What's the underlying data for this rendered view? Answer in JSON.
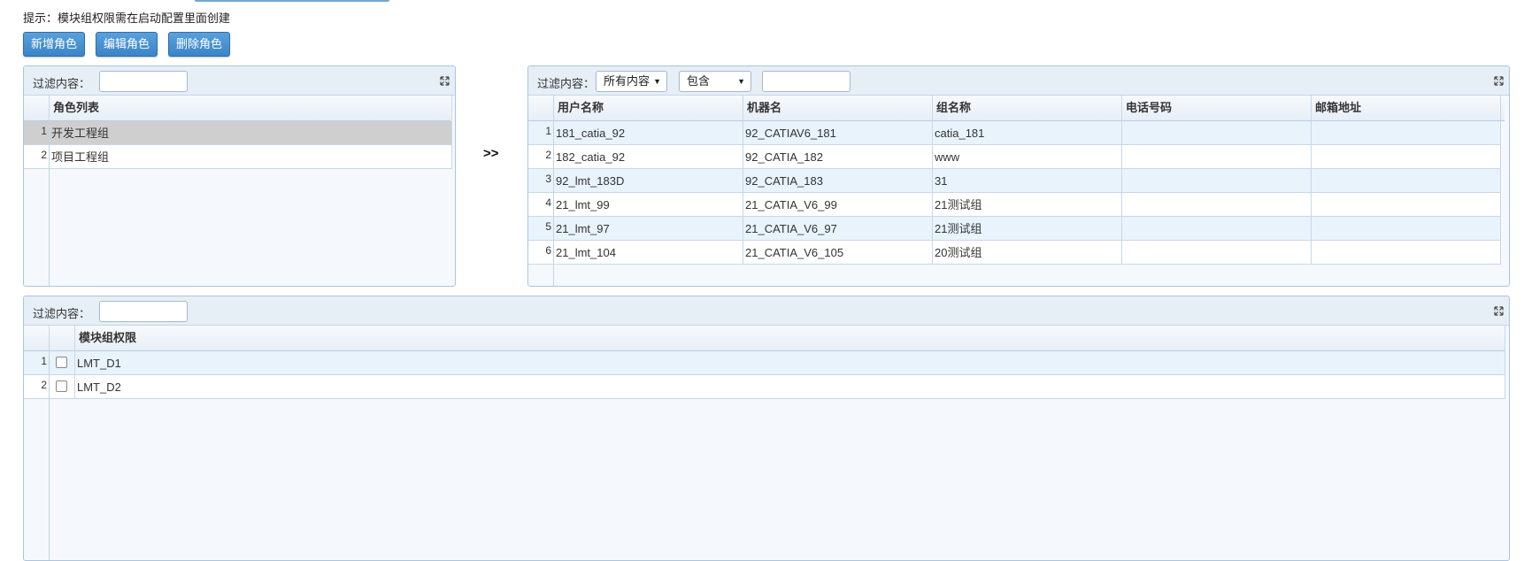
{
  "hint": "提示：模块组权限需在启动配置里面创建",
  "toolbar": {
    "add_label": "新增角色",
    "edit_label": "编辑角色",
    "delete_label": "删除角色"
  },
  "role_panel": {
    "filter_label": "过滤内容：",
    "filter_value": "",
    "column_header": "角色列表",
    "rows": [
      {
        "num": "1",
        "name": "开发工程组"
      },
      {
        "num": "2",
        "name": "项目工程组"
      }
    ]
  },
  "transfer_arrow": ">>",
  "user_panel": {
    "filter_label": "过滤内容：",
    "field_select": "所有内容",
    "op_select": "包含",
    "filter_value": "",
    "headers": [
      "用户名称",
      "机器名",
      "组名称",
      "电话号码",
      "邮箱地址"
    ],
    "rows": [
      {
        "num": "1",
        "user": "181_catia_92",
        "machine": "92_CATIAV6_181",
        "group": "catia_181",
        "phone": "",
        "email": ""
      },
      {
        "num": "2",
        "user": "182_catia_92",
        "machine": "92_CATIA_182",
        "group": "www",
        "phone": "",
        "email": ""
      },
      {
        "num": "3",
        "user": "92_lmt_183D",
        "machine": "92_CATIA_183",
        "group": "31",
        "phone": "",
        "email": ""
      },
      {
        "num": "4",
        "user": "21_lmt_99",
        "machine": "21_CATIA_V6_99",
        "group": "21测试组",
        "phone": "",
        "email": ""
      },
      {
        "num": "5",
        "user": "21_lmt_97",
        "machine": "21_CATIA_V6_97",
        "group": "21测试组",
        "phone": "",
        "email": ""
      },
      {
        "num": "6",
        "user": "21_lmt_104",
        "machine": "21_CATIA_V6_105",
        "group": "20测试组",
        "phone": "",
        "email": ""
      }
    ]
  },
  "module_panel": {
    "filter_label": "过滤内容：",
    "filter_value": "",
    "column_header": "模块组权限",
    "rows": [
      {
        "num": "1",
        "name": "LMT_D1",
        "checked": false
      },
      {
        "num": "2",
        "name": "LMT_D2",
        "checked": false
      }
    ]
  },
  "colors": {
    "accent": "#3a85c8",
    "panel_bg": "#f5f9fd",
    "row_alt": "#e8f3fc",
    "row_selected": "#cfcfcf"
  },
  "icons": {
    "expand": "expand-icon",
    "dropdown": "caret-down-icon"
  }
}
